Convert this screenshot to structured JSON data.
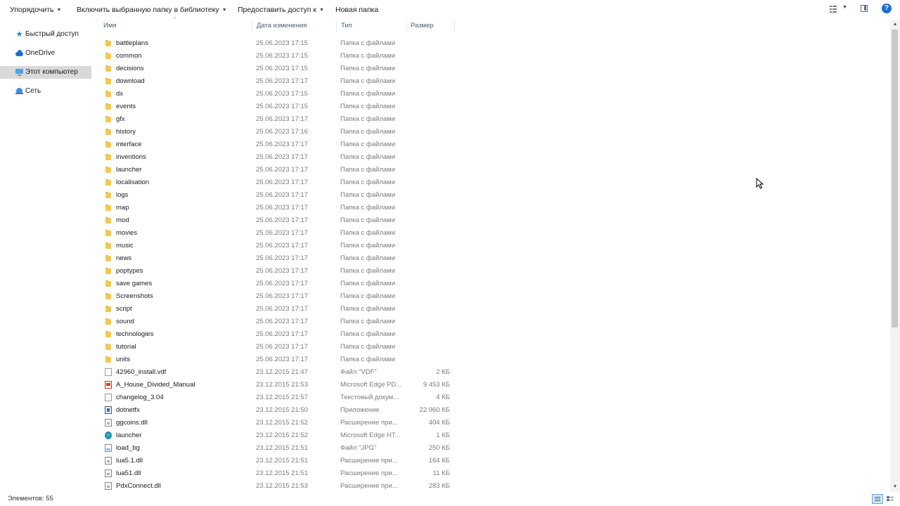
{
  "toolbar": {
    "organize": "Упорядочить",
    "include_library": "Включить выбранную папку в библиотеку",
    "share_with": "Предоставить доступ к",
    "new_folder": "Новая папка",
    "view_icon": "details-view-icon",
    "preview_icon": "preview-pane-icon",
    "help_label": "?"
  },
  "nav": {
    "items": [
      {
        "label": "Быстрый доступ",
        "icon": "star-icon"
      },
      {
        "label": "OneDrive",
        "icon": "cloud-icon"
      },
      {
        "label": "Этот компьютер",
        "icon": "computer-icon",
        "selected": true
      },
      {
        "label": "Сеть",
        "icon": "network-icon"
      }
    ]
  },
  "columns": {
    "name": "Имя",
    "date": "Дата изменения",
    "type": "Тип",
    "size": "Размер"
  },
  "files": [
    {
      "name": "battleplans",
      "date": "25.06.2023 17:15",
      "type": "Папка с файлами",
      "size": "",
      "icon": "folder"
    },
    {
      "name": "common",
      "date": "25.06.2023 17:15",
      "type": "Папка с файлами",
      "size": "",
      "icon": "folder"
    },
    {
      "name": "decisions",
      "date": "25.06.2023 17:15",
      "type": "Папка с файлами",
      "size": "",
      "icon": "folder"
    },
    {
      "name": "download",
      "date": "25.06.2023 17:17",
      "type": "Папка с файлами",
      "size": "",
      "icon": "folder"
    },
    {
      "name": "dx",
      "date": "25.06.2023 17:15",
      "type": "Папка с файлами",
      "size": "",
      "icon": "folder"
    },
    {
      "name": "events",
      "date": "25.06.2023 17:15",
      "type": "Папка с файлами",
      "size": "",
      "icon": "folder"
    },
    {
      "name": "gfx",
      "date": "25.06.2023 17:17",
      "type": "Папка с файлами",
      "size": "",
      "icon": "folder"
    },
    {
      "name": "history",
      "date": "25.06.2023 17:16",
      "type": "Папка с файлами",
      "size": "",
      "icon": "folder"
    },
    {
      "name": "interface",
      "date": "25.06.2023 17:17",
      "type": "Папка с файлами",
      "size": "",
      "icon": "folder"
    },
    {
      "name": "inventions",
      "date": "25.06.2023 17:17",
      "type": "Папка с файлами",
      "size": "",
      "icon": "folder"
    },
    {
      "name": "launcher",
      "date": "25.06.2023 17:17",
      "type": "Папка с файлами",
      "size": "",
      "icon": "folder"
    },
    {
      "name": "localisation",
      "date": "25.06.2023 17:17",
      "type": "Папка с файлами",
      "size": "",
      "icon": "folder"
    },
    {
      "name": "logs",
      "date": "25.06.2023 17:17",
      "type": "Папка с файлами",
      "size": "",
      "icon": "folder"
    },
    {
      "name": "map",
      "date": "25.06.2023 17:17",
      "type": "Папка с файлами",
      "size": "",
      "icon": "folder"
    },
    {
      "name": "mod",
      "date": "25.06.2023 17:17",
      "type": "Папка с файлами",
      "size": "",
      "icon": "folder"
    },
    {
      "name": "movies",
      "date": "25.06.2023 17:17",
      "type": "Папка с файлами",
      "size": "",
      "icon": "folder"
    },
    {
      "name": "music",
      "date": "25.06.2023 17:17",
      "type": "Папка с файлами",
      "size": "",
      "icon": "folder"
    },
    {
      "name": "news",
      "date": "25.06.2023 17:17",
      "type": "Папка с файлами",
      "size": "",
      "icon": "folder"
    },
    {
      "name": "poptypes",
      "date": "25.06.2023 17:17",
      "type": "Папка с файлами",
      "size": "",
      "icon": "folder"
    },
    {
      "name": "save games",
      "date": "25.06.2023 17:17",
      "type": "Папка с файлами",
      "size": "",
      "icon": "folder"
    },
    {
      "name": "Screenshots",
      "date": "25.06.2023 17:17",
      "type": "Папка с файлами",
      "size": "",
      "icon": "folder"
    },
    {
      "name": "script",
      "date": "25.06.2023 17:17",
      "type": "Папка с файлами",
      "size": "",
      "icon": "folder"
    },
    {
      "name": "sound",
      "date": "25.06.2023 17:17",
      "type": "Папка с файлами",
      "size": "",
      "icon": "folder"
    },
    {
      "name": "technologies",
      "date": "25.06.2023 17:17",
      "type": "Папка с файлами",
      "size": "",
      "icon": "folder"
    },
    {
      "name": "tutorial",
      "date": "25.06.2023 17:17",
      "type": "Папка с файлами",
      "size": "",
      "icon": "folder"
    },
    {
      "name": "units",
      "date": "25.06.2023 17:17",
      "type": "Папка с файлами",
      "size": "",
      "icon": "folder"
    },
    {
      "name": "42960_install.vdf",
      "date": "23.12.2015 21:47",
      "type": "Файл \"VDF\"",
      "size": "2 КБ",
      "icon": "file"
    },
    {
      "name": "A_House_Divided_Manual",
      "date": "23.12.2015 21:53",
      "type": "Microsoft Edge PD...",
      "size": "9 453 КБ",
      "icon": "pdf"
    },
    {
      "name": "changelog_3.04",
      "date": "23.12.2015 21:57",
      "type": "Текстовый докум...",
      "size": "4 КБ",
      "icon": "file"
    },
    {
      "name": "dotnetfx",
      "date": "23.12.2015 21:50",
      "type": "Приложение",
      "size": "22 960 КБ",
      "icon": "app"
    },
    {
      "name": "ggcoins.dll",
      "date": "23.12.2015 21:52",
      "type": "Расширение при...",
      "size": "404 КБ",
      "icon": "dll"
    },
    {
      "name": "launcher",
      "date": "23.12.2015 21:52",
      "type": "Microsoft Edge HT...",
      "size": "1 КБ",
      "icon": "edge"
    },
    {
      "name": "load_bg",
      "date": "23.12.2015 21:51",
      "type": "Файл \"JPG\"",
      "size": "250 КБ",
      "icon": "img"
    },
    {
      "name": "lua5.1.dll",
      "date": "23.12.2015 21:51",
      "type": "Расширение при...",
      "size": "164 КБ",
      "icon": "dll"
    },
    {
      "name": "lua51.dll",
      "date": "23.12.2015 21:51",
      "type": "Расширение при...",
      "size": "11 КБ",
      "icon": "dll"
    },
    {
      "name": "PdxConnect.dll",
      "date": "23.12.2015 21:53",
      "type": "Расширение при...",
      "size": "283 КБ",
      "icon": "dll"
    }
  ],
  "status": {
    "items_count": "Элементов: 55"
  },
  "colors": {
    "accent": "#1a6fd3",
    "folder": "#f4c84b",
    "selection": "#d9d9d9"
  }
}
